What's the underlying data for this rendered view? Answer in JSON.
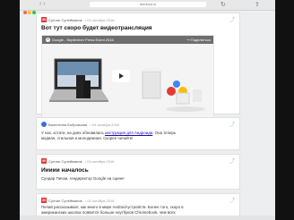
{
  "browser": {
    "url": "meduza.io",
    "traffic_colors": [
      "#ff5f57",
      "#ffbd2e",
      "#28c840"
    ]
  },
  "posts": [
    {
      "author": "Султан Сулейманов",
      "date": "• 04 октября 2016",
      "title": "Вот тут скоро будет видеотрансляция",
      "video_title": "Google - September Press Event 2016",
      "video_share": "↪ Поделиться"
    },
    {
      "author": "Валентина Бобровская",
      "date": "• 04 октября 2016",
      "text_before": "У нас, кстати, на днях обновилась ",
      "link": "инструкция для Андроида",
      "text_after": ". Она теперь",
      "text_line2": "модная, стильная и молодежная. Скорее читайте!"
    },
    {
      "author": "Султан Сулейманов",
      "date": "• 04 октября 2016",
      "title": "Иииии началось",
      "text": "Сундар Пичаи, гендиректор Google на сцене!"
    },
    {
      "author": "Султан Сулейманов",
      "date": "• 04 октября 2016",
      "text_line1": "Пичай рассказывает, как много в мире Android-устройств. Более того, скоро в",
      "text_line2": "американских школах появится больше ноутбуков Chromebook, чем всех"
    }
  ],
  "icons": {
    "logo": "meduza-logo-icon",
    "share": "share-icon",
    "play": "play-icon"
  }
}
